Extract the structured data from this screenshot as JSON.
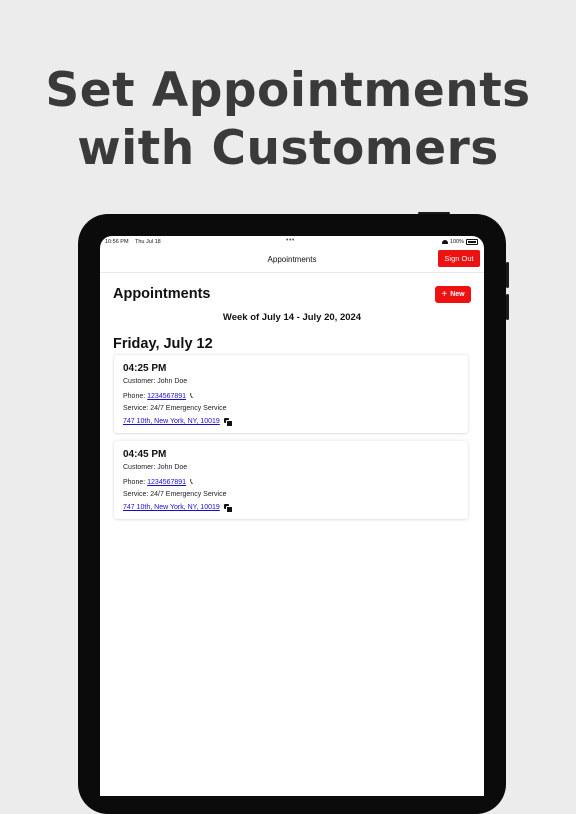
{
  "headline": {
    "line1": "Set Appointments",
    "line2": "with Customers"
  },
  "status_bar": {
    "time": "10:56 PM",
    "date": "Thu Jul 18",
    "dots": "•••",
    "battery": "100%"
  },
  "nav": {
    "title": "Appointments",
    "sign_out_label": "Sign Out"
  },
  "main": {
    "title": "Appointments",
    "new_button_label": "New",
    "new_button_icon": "+",
    "week_label": "Week of July 14 - July 20, 2024",
    "day_label": "Friday, July 12"
  },
  "appointments": [
    {
      "time": "04:25 PM",
      "customer_label": "Customer: John Doe",
      "phone_prefix": "Phone: ",
      "phone": "1234567891",
      "service": "Service: 24/7 Emergency Service",
      "address": "747 10th, New York, NY, 10019"
    },
    {
      "time": "04:45 PM",
      "customer_label": "Customer: John Doe",
      "phone_prefix": "Phone: ",
      "phone": "1234567891",
      "service": "Service: 24/7 Emergency Service",
      "address": "747 10th, New York, NY, 10019"
    }
  ],
  "colors": {
    "accent": "#ee1111",
    "background": "#ececec",
    "link": "#1a0dcc",
    "headline": "#3a3a3a"
  },
  "icons": {
    "phone": "phone-icon",
    "copy": "copy-icon",
    "plus": "plus-icon",
    "wifi": "wifi-icon",
    "battery": "battery-icon"
  }
}
